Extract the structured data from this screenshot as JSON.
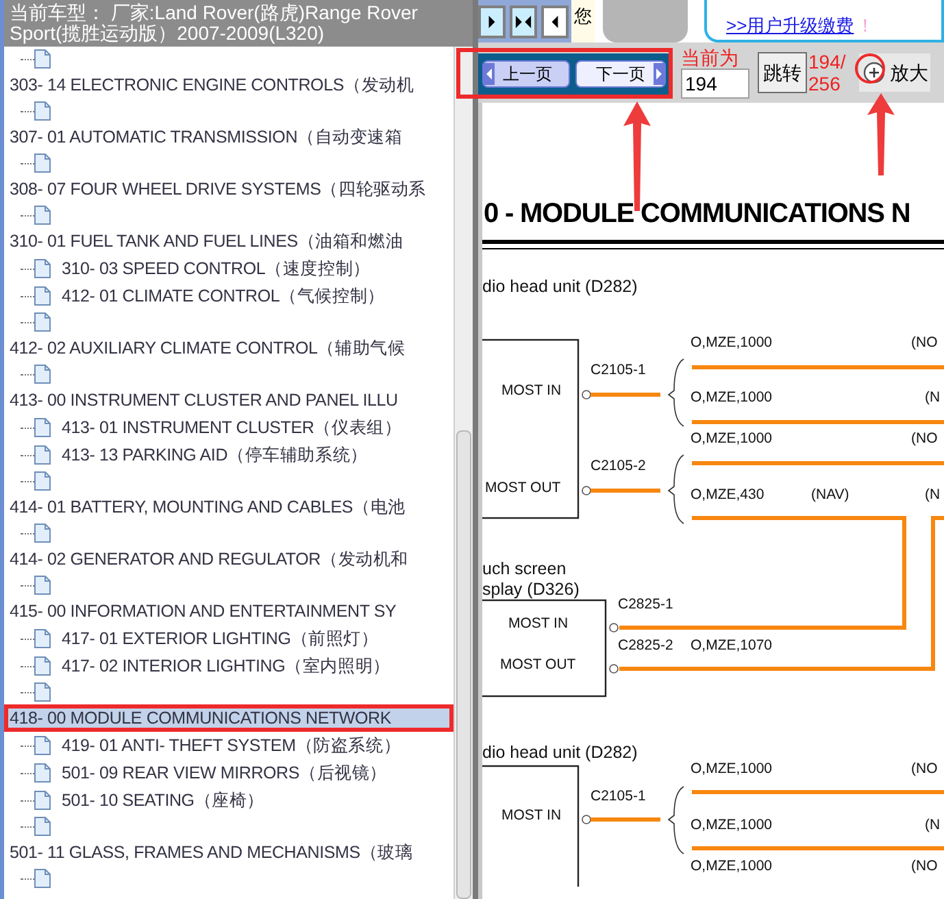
{
  "model_header": [
    "当前车型：  厂家:Land Rover(路虎)Range Rover",
    "Sport(揽胜运动版）2007-2009(L320)"
  ],
  "tree": [
    {
      "children": [
        {
          "kind": "page"
        }
      ]
    },
    {
      "label": "303- 14 ELECTRONIC ENGINE CONTROLS（发动机",
      "selected": false,
      "children": [
        {
          "kind": "page"
        }
      ]
    },
    {
      "label": "307- 01 AUTOMATIC TRANSMISSION（自动变速箱",
      "selected": false,
      "children": [
        {
          "kind": "page"
        }
      ]
    },
    {
      "label": "308- 07 FOUR WHEEL DRIVE SYSTEMS（四轮驱动系",
      "selected": false,
      "children": [
        {
          "kind": "page"
        }
      ]
    },
    {
      "label": "310- 01 FUEL TANK AND FUEL LINES（油箱和燃油",
      "selected": false,
      "children": [
        {
          "kind": "item",
          "label": "310- 03 SPEED CONTROL（速度控制）"
        },
        {
          "kind": "item",
          "label": "412- 01 CLIMATE CONTROL（气候控制）"
        },
        {
          "kind": "page"
        }
      ]
    },
    {
      "label": "412- 02 AUXILIARY CLIMATE CONTROL（辅助气候",
      "selected": false,
      "children": [
        {
          "kind": "page"
        }
      ]
    },
    {
      "label": "413- 00 INSTRUMENT CLUSTER AND PANEL ILLU",
      "selected": false,
      "children": [
        {
          "kind": "item",
          "label": "413- 01 INSTRUMENT CLUSTER（仪表组）"
        },
        {
          "kind": "item",
          "label": "413- 13 PARKING AID（停车辅助系统）"
        },
        {
          "kind": "page"
        }
      ]
    },
    {
      "label": "414- 01 BATTERY, MOUNTING AND CABLES（电池",
      "selected": false,
      "children": [
        {
          "kind": "page"
        }
      ]
    },
    {
      "label": "414- 02 GENERATOR AND REGULATOR（发动机和",
      "selected": false,
      "children": [
        {
          "kind": "page"
        }
      ]
    },
    {
      "label": "415- 00 INFORMATION AND ENTERTAINMENT SY",
      "selected": false,
      "children": [
        {
          "kind": "item",
          "label": "417- 01 EXTERIOR LIGHTING（前照灯）"
        },
        {
          "kind": "item",
          "label": "417- 02 INTERIOR LIGHTING（室内照明）"
        },
        {
          "kind": "page"
        }
      ]
    },
    {
      "label": "418- 00 MODULE COMMUNICATIONS NETWORK",
      "selected": true,
      "children": [
        {
          "kind": "item",
          "label": "419- 01 ANTI- THEFT SYSTEM（防盗系统）"
        },
        {
          "kind": "item",
          "label": "501- 09 REAR VIEW MIRRORS（后视镜）"
        },
        {
          "kind": "item",
          "label": "501- 10 SEATING（座椅）"
        },
        {
          "kind": "page"
        }
      ]
    },
    {
      "label": "501- 11 GLASS, FRAMES AND MECHANISMS（玻璃",
      "selected": false,
      "children": [
        {
          "kind": "page"
        }
      ]
    }
  ],
  "top_bar": {
    "greeting": "您",
    "upgrade_link": ">>用户升级缴费",
    "upgrade_mark": "！"
  },
  "pager": {
    "prev": "上一页",
    "next": "下一页",
    "current_label": "当前为",
    "page_input": "194",
    "jump": "跳转",
    "page_of": [
      "194/",
      "256"
    ],
    "zoom": "放大"
  },
  "document": {
    "title": "0 - MODULE COMMUNICATIONS N",
    "blocks": [
      {
        "caption": [
          "dio head unit (D282)"
        ],
        "pins": [
          "MOST IN",
          "MOST OUT"
        ]
      },
      {
        "caption": [
          "uch screen",
          "splay (D326)"
        ],
        "pins": [
          "MOST IN",
          "MOST OUT"
        ]
      },
      {
        "caption": [
          "dio head unit (D282)"
        ],
        "pins": [
          "MOST IN"
        ]
      }
    ],
    "connectors": [
      "C2105-1",
      "C2105-2",
      "C2825-1",
      "C2825-2",
      "C2105-1"
    ],
    "wires": [
      {
        "spec": "O,MZE,1000",
        "note": "(NO"
      },
      {
        "spec": "O,MZE,1000",
        "note": "(N"
      },
      {
        "spec": "O,MZE,1000",
        "note": "(NO"
      },
      {
        "spec": "O,MZE,430",
        "tag": "(NAV)",
        "note": "(N"
      },
      {
        "spec": "O,MZE,1070"
      },
      {
        "spec": "O,MZE,1000",
        "note": "(NO"
      },
      {
        "spec": "O,MZE,1000",
        "note": "(N"
      },
      {
        "spec": "O,MZE,1000",
        "note": "(NO"
      }
    ]
  }
}
